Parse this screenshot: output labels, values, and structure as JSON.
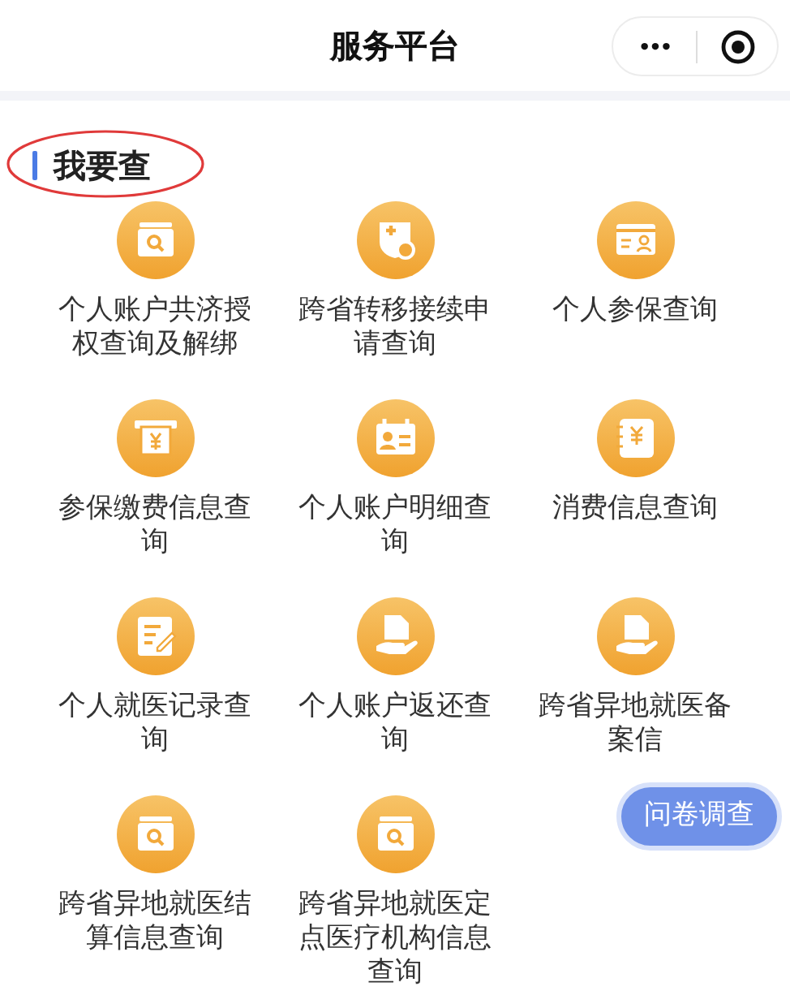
{
  "nav": {
    "title": "服务平台",
    "more_glyph": "•••"
  },
  "section": {
    "title": "我要查",
    "annotated": true
  },
  "services": [
    {
      "label": "个人账户共济授权查询及解绑"
    },
    {
      "label": "跨省转移接续申请查询"
    },
    {
      "label": "个人参保查询"
    },
    {
      "label": "参保缴费信息查询"
    },
    {
      "label": "个人账户明细查询"
    },
    {
      "label": "消费信息查询"
    },
    {
      "label": "个人就医记录查询"
    },
    {
      "label": "个人账户返还查询"
    },
    {
      "label": "跨省异地就医备案信"
    },
    {
      "label": "跨省异地就医结算信息查询"
    },
    {
      "label": "跨省异地就医定点医疗机构信息查询"
    }
  ],
  "float_button": {
    "label": "问卷调查"
  }
}
